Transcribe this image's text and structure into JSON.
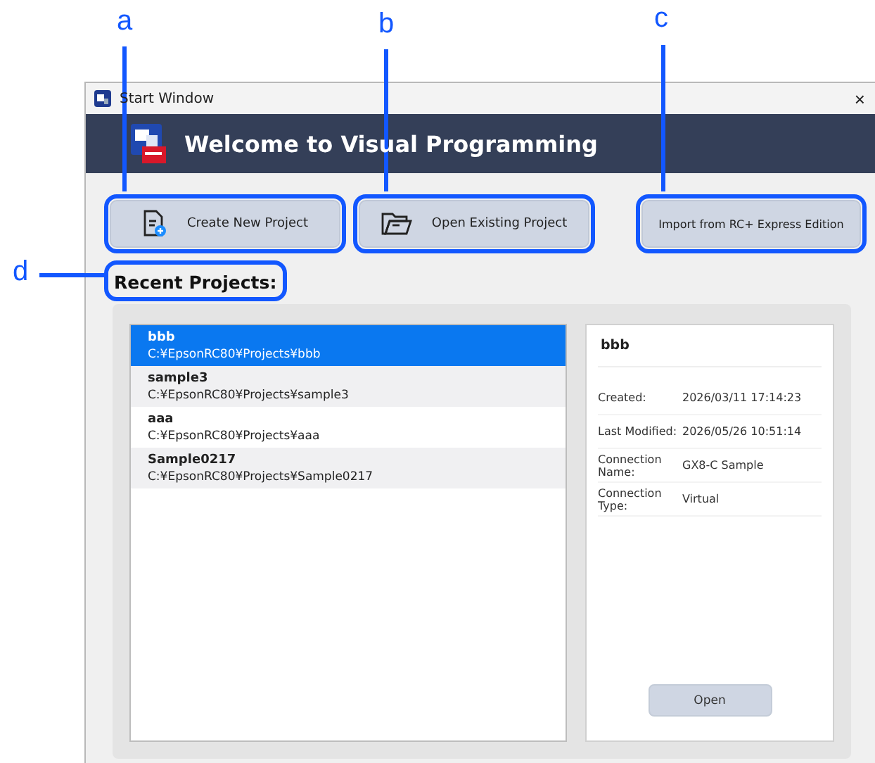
{
  "callouts": [
    {
      "label": "a"
    },
    {
      "label": "b"
    },
    {
      "label": "c"
    },
    {
      "label": "d"
    }
  ],
  "window": {
    "title": "Start Window",
    "close": "×"
  },
  "header": {
    "title": "Welcome to Visual Programming"
  },
  "buttons": [
    {
      "kind": "create",
      "label": "Create New Project"
    },
    {
      "kind": "open",
      "label": "Open Existing Project"
    },
    {
      "kind": "import",
      "label": "Import from RC+ Express Edition"
    }
  ],
  "recent_label": "Recent Projects:",
  "projects": [
    {
      "name": "bbb",
      "path": "C:¥EpsonRC80¥Projects¥bbb",
      "selected": true
    },
    {
      "name": "sample3",
      "path": "C:¥EpsonRC80¥Projects¥sample3",
      "selected": false
    },
    {
      "name": "aaa",
      "path": "C:¥EpsonRC80¥Projects¥aaa",
      "selected": false
    },
    {
      "name": "Sample0217",
      "path": "C:¥EpsonRC80¥Projects¥Sample0217",
      "selected": false
    }
  ],
  "details": {
    "title": "bbb",
    "fields": [
      {
        "label": "Created:",
        "value": "2026/03/11 17:14:23"
      },
      {
        "label": "Last Modified:",
        "value": "2026/05/26 10:51:14"
      },
      {
        "label": "Connection Name:",
        "value": "GX8-C Sample"
      },
      {
        "label": "Connection Type:",
        "value": "Virtual"
      }
    ],
    "open_button": "Open"
  }
}
